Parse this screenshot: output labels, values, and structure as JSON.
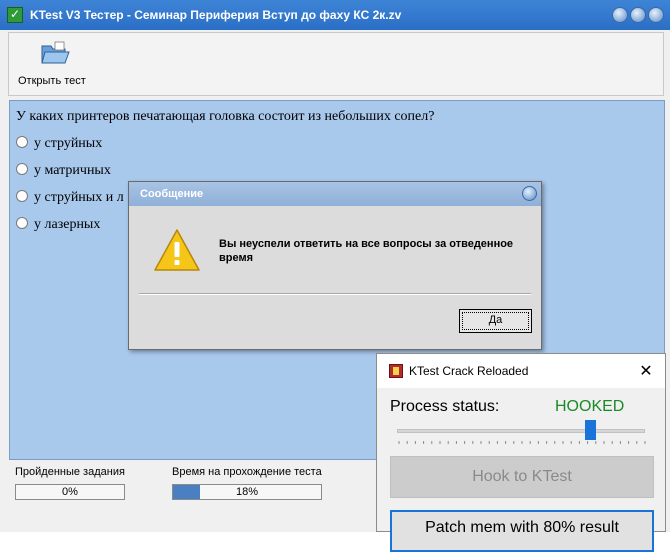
{
  "main_window": {
    "title": "KTest V3 Тестер - Семинар Периферия Вступ до фаху КС 2к.zv"
  },
  "toolbar": {
    "open_label": "Открыть тест"
  },
  "question": {
    "text": "У каких принтеров печатающая головка состоит из небольших сопел?",
    "options": [
      {
        "label": "у струйных"
      },
      {
        "label": "у матричных"
      },
      {
        "label": "у струйных и л"
      },
      {
        "label": "у лазерных"
      }
    ]
  },
  "status": {
    "completed_label": "Пройденные задания",
    "completed_value": "0%",
    "completed_fraction": 0,
    "time_label": "Время на прохождение теста",
    "time_value": "18%",
    "time_fraction": 0.18
  },
  "message_dialog": {
    "title": "Сообщение",
    "text": "Вы неуспели ответить на все вопросы за отведенное время",
    "ok_label": "Да"
  },
  "crack_window": {
    "title": "KTest Crack Reloaded",
    "close_glyph": "✕",
    "process_label": "Process status:",
    "process_value": "HOOKED",
    "process_color": "#1a8a28",
    "slider_fraction": 0.78,
    "hook_label": "Hook to KTest",
    "patch_label": "Patch mem with 80% result"
  }
}
